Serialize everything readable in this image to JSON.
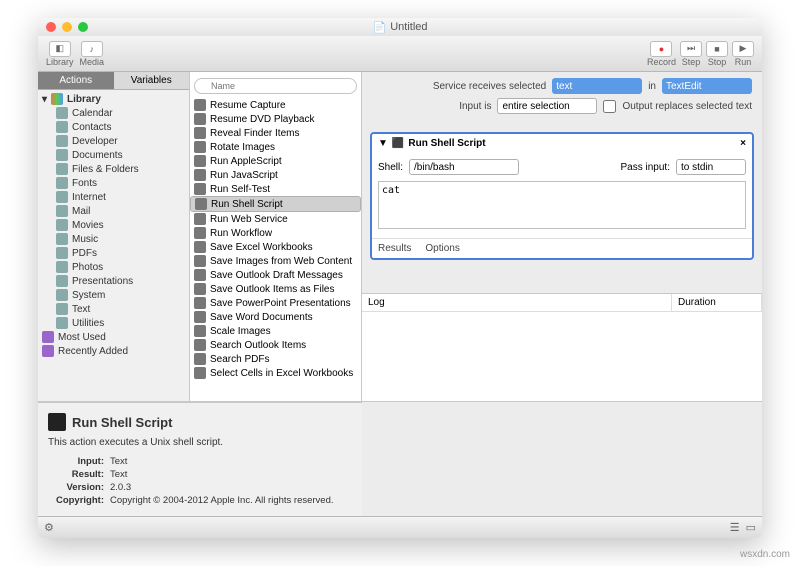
{
  "window": {
    "title": "Untitled"
  },
  "toolbar": {
    "library": "Library",
    "media": "Media",
    "record": "Record",
    "step": "Step",
    "stop": "Stop",
    "run": "Run"
  },
  "sidebar": {
    "tabs": {
      "actions": "Actions",
      "variables": "Variables"
    },
    "search_placeholder": "Name",
    "root": "Library",
    "items": [
      "Calendar",
      "Contacts",
      "Developer",
      "Documents",
      "Files & Folders",
      "Fonts",
      "Internet",
      "Mail",
      "Movies",
      "Music",
      "PDFs",
      "Photos",
      "Presentations",
      "System",
      "Text",
      "Utilities"
    ],
    "extras": [
      "Most Used",
      "Recently Added"
    ]
  },
  "actions": {
    "items": [
      "Resume Capture",
      "Resume DVD Playback",
      "Reveal Finder Items",
      "Rotate Images",
      "Run AppleScript",
      "Run JavaScript",
      "Run Self-Test",
      "Run Shell Script",
      "Run Web Service",
      "Run Workflow",
      "Save Excel Workbooks",
      "Save Images from Web Content",
      "Save Outlook Draft Messages",
      "Save Outlook Items as Files",
      "Save PowerPoint Presentations",
      "Save Word Documents",
      "Scale Images",
      "Search Outlook Items",
      "Search PDFs",
      "Select Cells in Excel Workbooks"
    ],
    "selected": "Run Shell Script"
  },
  "workflow": {
    "receives_label": "Service receives selected",
    "receives_value": "text",
    "in_label": "in",
    "in_value": "TextEdit",
    "input_is_label": "Input is",
    "input_is_value": "entire selection",
    "replace_label": "Output replaces selected text",
    "step_title": "Run Shell Script",
    "shell_label": "Shell:",
    "shell_value": "/bin/bash",
    "pass_label": "Pass input:",
    "pass_value": "to stdin",
    "script": "cat",
    "results": "Results",
    "options": "Options"
  },
  "description": {
    "title": "Run Shell Script",
    "body": "This action executes a Unix shell script.",
    "input_label": "Input:",
    "input_value": "Text",
    "result_label": "Result:",
    "result_value": "Text",
    "version_label": "Version:",
    "version_value": "2.0.3",
    "copyright_label": "Copyright:",
    "copyright_value": "Copyright © 2004-2012 Apple Inc. All rights reserved."
  },
  "log": {
    "col1": "Log",
    "col2": "Duration"
  },
  "watermark": "wsxdn.com"
}
